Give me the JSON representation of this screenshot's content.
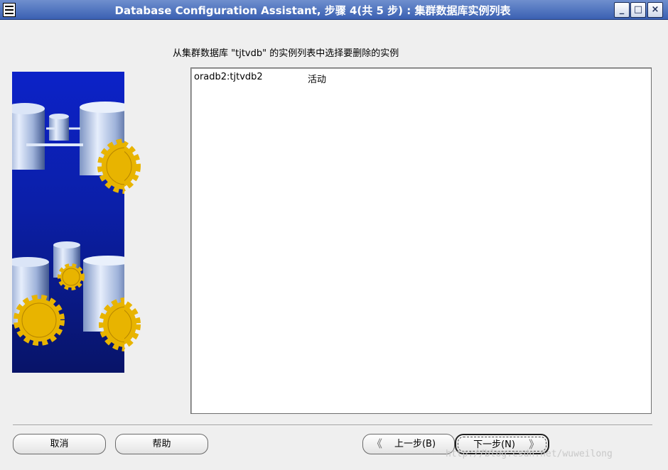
{
  "window": {
    "title": "Database Configuration Assistant, 步骤 4(共 5 步) : 集群数据库实例列表",
    "controls": [
      "_",
      "□",
      "×"
    ]
  },
  "instruction": "从集群数据库 \"tjtvdb\" 的实例列表中选择要删除的实例",
  "instances": [
    {
      "name": "oradb2:tjtvdb2",
      "status": "活动"
    }
  ],
  "buttons": {
    "cancel": "取消",
    "help": "帮助",
    "back": "上一步(B)",
    "next": "下一步(N)"
  },
  "watermark": "http://blog.csdn.net/wuweilong",
  "colors": {
    "titlebar": "#3a60b2",
    "art_background": "#0b1fa8",
    "gear": "#e8b400"
  }
}
